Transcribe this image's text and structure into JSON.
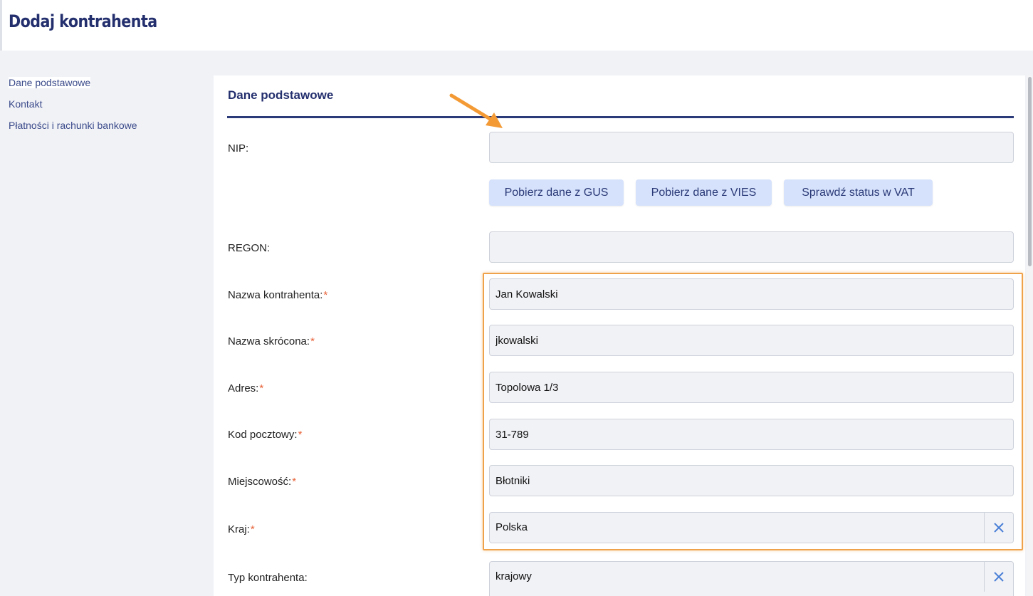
{
  "page_title": "Dodaj kontrahenta",
  "sidebar": {
    "items": [
      {
        "label": "Dane podstawowe"
      },
      {
        "label": "Kontakt"
      },
      {
        "label": "Płatności i rachunki bankowe"
      }
    ]
  },
  "section": {
    "title": "Dane podstawowe"
  },
  "fields": {
    "nip": {
      "label": "NIP:",
      "value": ""
    },
    "regon": {
      "label": "REGON:",
      "value": ""
    },
    "nazwa_kontrahenta": {
      "label": "Nazwa kontrahenta:",
      "value": "Jan Kowalski"
    },
    "nazwa_skrocona": {
      "label": "Nazwa skrócona:",
      "value": "jkowalski"
    },
    "adres": {
      "label": "Adres:",
      "value": "Topolowa 1/3"
    },
    "kod_pocztowy": {
      "label": "Kod pocztowy:",
      "value": "31-789"
    },
    "miejscowosc": {
      "label": "Miejscowość:",
      "value": "Błotniki"
    },
    "kraj": {
      "label": "Kraj:",
      "value": "Polska"
    },
    "typ_kontrahenta": {
      "label": "Typ kontrahenta:",
      "value": "krajowy"
    }
  },
  "required_marker": "*",
  "buttons": {
    "gus": "Pobierz dane z GUS",
    "vies": "Pobierz dane z VIES",
    "vat": "Sprawdź status w VAT"
  },
  "icons": {
    "clear": "close-icon",
    "annotation": "arrow-icon"
  },
  "colors": {
    "title": "#24306e",
    "accent_rule": "#2b3a78",
    "button_bg": "#d6e2fb",
    "required": "#e8633a",
    "highlight": "#f0a24a",
    "clear_icon": "#4a7fd6"
  }
}
